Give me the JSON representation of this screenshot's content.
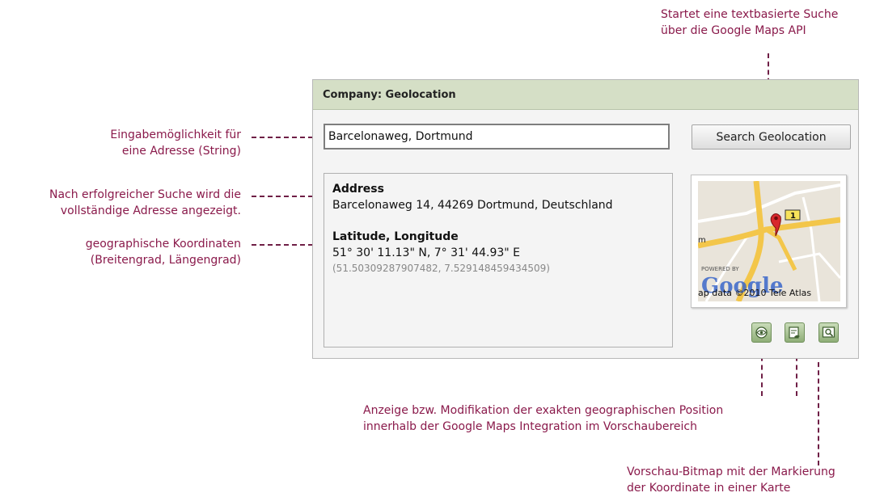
{
  "annotations": {
    "search_note": [
      "Startet eine textbasierte Suche",
      "über die Google Maps API"
    ],
    "input_note": [
      "Eingabemöglichkeit für",
      "eine Adresse (String)"
    ],
    "address_note": [
      "Nach erfolgreicher Suche wird die",
      "vollständige Adresse angezeigt."
    ],
    "coords_note": [
      "geographische Koordinaten",
      "(Breitengrad, Längengrad)"
    ],
    "position_note": [
      "Anzeige bzw. Modifikation der exakten geographischen Position",
      "innerhalb der Google Maps Integration im Vorschaubereich"
    ],
    "bitmap_note": [
      "Vorschau-Bitmap mit der Markierung",
      "der Koordinate in einer Karte"
    ]
  },
  "panel": {
    "title": "Company: Geolocation",
    "input_value": "Barcelonaweg, Dortmund",
    "search_button": "Search Geolocation",
    "address_label": "Address",
    "address_value": "Barcelonaweg 14, 44269 Dortmund, Deutschland",
    "coords_label": "Latitude, Longitude",
    "coords_dms": "51° 30' 11.13\" N, 7° 31' 44.93\" E",
    "coords_decimal": "(51.50309287907482, 7.529148459434509)",
    "map": {
      "road_number": "1",
      "powered_by": "POWERED BY",
      "brand": "Google",
      "attribution": "ap data ©2010 Tele Atlas",
      "edge_text": "m"
    },
    "icons": [
      "show-position-icon",
      "edit-position-icon",
      "preview-zoom-icon"
    ]
  },
  "colors": {
    "annotation": "#8a1a4b",
    "header_bg": "#d5dfc6",
    "icon_green": "#8fae78"
  }
}
